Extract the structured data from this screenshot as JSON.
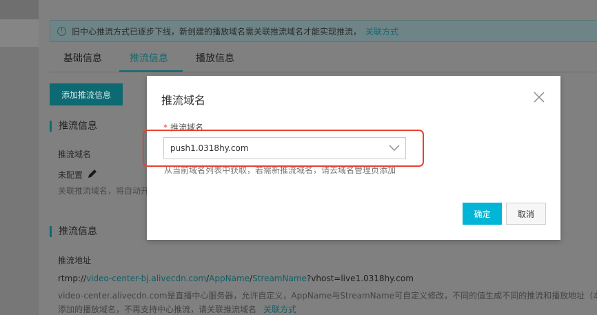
{
  "notice": {
    "text": "旧中心推流方式已逐步下线，新创建的播放域名需关联推流域名才能实现推流，",
    "link": "关联方式"
  },
  "tabs": [
    {
      "label": "基础信息",
      "active": false
    },
    {
      "label": "推流信息",
      "active": true
    },
    {
      "label": "播放信息",
      "active": false
    }
  ],
  "add_button": "添加推流信息",
  "section1": {
    "title": "推流信息",
    "domain_label": "推流域名",
    "status": "未配置",
    "help": "关联推流域名，将自动开"
  },
  "section2": {
    "title": "推流信息",
    "address_label": "推流地址",
    "url_prefix": "rtmp://",
    "url_host": "video-center-bj.alivecdn.com",
    "url_sep1": "/",
    "url_app": "AppName",
    "url_sep2": "/",
    "url_stream": "StreamName",
    "url_query": "?vhost=live1.0318hy.com",
    "desc_line1": "video-center.alivecdn.com是直播中心服务器，允许自定义，AppName与StreamName可自定义修改，不同的值生成不同的推流和播放地址（本方式",
    "desc_line2": "添加的播放域名，不再支持中心推流，请关联推流域名",
    "desc_link": "关联方式"
  },
  "modal": {
    "title": "推流域名",
    "field_label": "推流域名",
    "required_mark": "*",
    "selected_value": "push1.0318hy.com",
    "help_text": "从当前域名列表中获取，若需新推流域名，请去域名管理页添加",
    "ok_label": "确定",
    "cancel_label": "取消"
  },
  "colors": {
    "accent": "#00b5d6",
    "highlight": "#e8412f"
  },
  "icons": {
    "notice": "info-icon",
    "edit": "pencil-icon",
    "close": "close-icon",
    "dropdown": "chevron-down-icon"
  }
}
